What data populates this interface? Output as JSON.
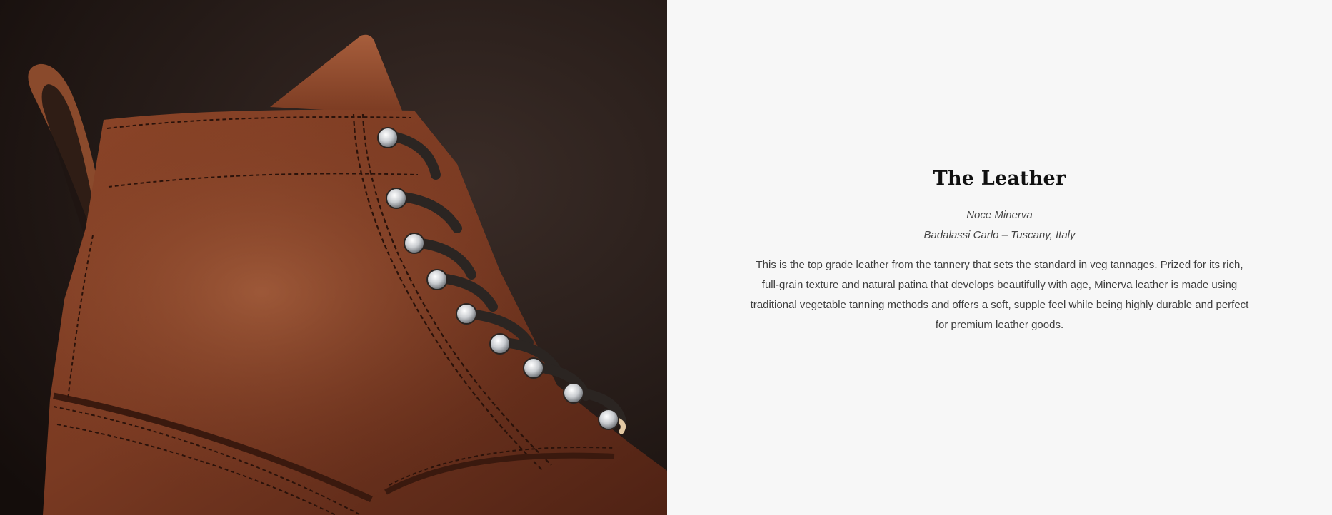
{
  "media": {
    "image_alt": "Close-up of a brown leather lace-up boot with metal eyelets and dark laces",
    "colors": {
      "background_dark": "#1f1512",
      "leather_main": "#7a3a22",
      "leather_highlight": "#a45a38",
      "leather_shadow": "#4a2013",
      "stitch": "#2a120a",
      "lace": "#2b2522",
      "eyelet": "#c9ccd0"
    }
  },
  "section": {
    "title": "The Leather",
    "leather_name": "Noce Minerva",
    "tannery": "Badalassi Carlo – Tuscany, Italy",
    "description": "This is the top grade leather from the tannery that sets the standard in veg tannages. Prized for its rich, full-grain texture and natural patina that develops beautifully with age, Minerva leather is made using traditional vegetable tanning methods and offers a soft, supple feel while being highly durable and perfect for premium leather goods."
  }
}
